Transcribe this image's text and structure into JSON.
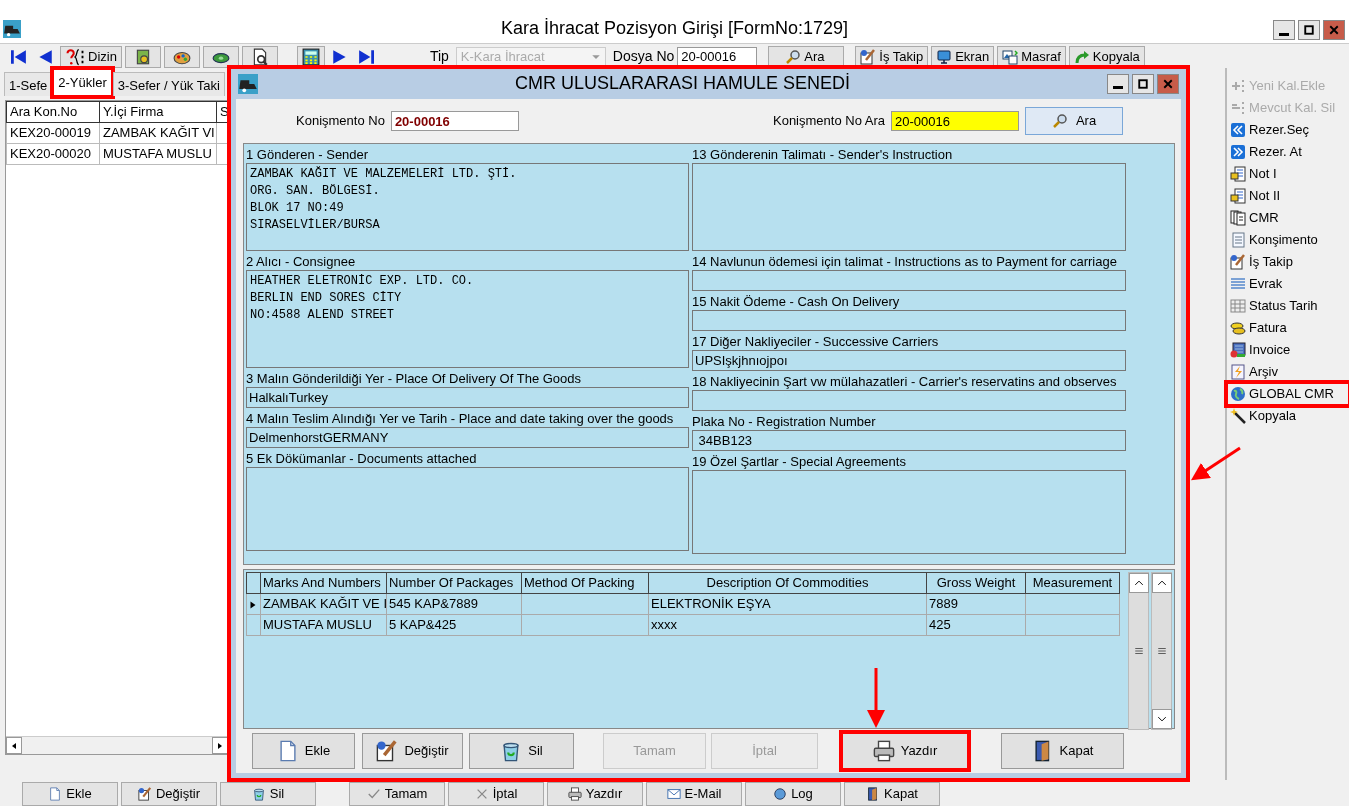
{
  "window": {
    "title": "Kara İhracat Pozisyon Girişi [FormNo:1729]"
  },
  "toolbar": {
    "index_button": "Dizin",
    "type_label": "Tip",
    "type_value": "K-Kara İhracat",
    "file_label": "Dosya No",
    "file_value": "20-00016",
    "search_button": "Ara",
    "buttons": [
      "İş Takip",
      "Ekran",
      "Masraf",
      "Kopyala"
    ]
  },
  "tabs": [
    {
      "label": "1-Sefe",
      "selected": false,
      "highlighted": false
    },
    {
      "label": "2-Yükler",
      "selected": true,
      "highlighted": true
    },
    {
      "label": "3-Sefer / Yük Taki",
      "selected": false,
      "highlighted": false
    }
  ],
  "left_table": {
    "columns": [
      "Ara Kon.No",
      "Y.İçi Firma",
      "S"
    ],
    "rows": [
      [
        "KEX20-00019",
        "ZAMBAK KAĞIT VI"
      ],
      [
        "KEX20-00020",
        "MUSTAFA MUSLU"
      ]
    ]
  },
  "sidebar": {
    "items": [
      {
        "label": "Yeni Kal.Ekle",
        "disabled": true,
        "highlighted": false
      },
      {
        "label": "Mevcut Kal. Sil",
        "disabled": true,
        "highlighted": false
      },
      {
        "label": "Rezer.Seç",
        "disabled": false,
        "highlighted": false
      },
      {
        "label": "Rezer. At",
        "disabled": false,
        "highlighted": false
      },
      {
        "label": "Not I",
        "disabled": false,
        "highlighted": false
      },
      {
        "label": "Not II",
        "disabled": false,
        "highlighted": false
      },
      {
        "label": "CMR",
        "disabled": false,
        "highlighted": false
      },
      {
        "label": "Konşimento",
        "disabled": false,
        "highlighted": false
      },
      {
        "label": "İş Takip",
        "disabled": false,
        "highlighted": false
      },
      {
        "label": "Evrak",
        "disabled": false,
        "highlighted": false
      },
      {
        "label": "Status Tarih",
        "disabled": false,
        "highlighted": false
      },
      {
        "label": "Fatura",
        "disabled": false,
        "highlighted": false
      },
      {
        "label": "Invoice",
        "disabled": false,
        "highlighted": false
      },
      {
        "label": "Arşiv",
        "disabled": false,
        "highlighted": false
      },
      {
        "label": "GLOBAL CMR",
        "disabled": false,
        "highlighted": true
      },
      {
        "label": "Kopyala",
        "disabled": false,
        "highlighted": false
      }
    ]
  },
  "bottom_buttons": [
    "Ekle",
    "Değiştir",
    "Sil",
    "Tamam",
    "İptal",
    "Yazdır",
    "E-Mail",
    "Log",
    "Kapat"
  ],
  "dialog": {
    "title": "CMR ULUSLARARASI HAMULE SENEDİ",
    "highlighted": true,
    "bill_no": {
      "label": "Konişmento No",
      "value": "20-00016"
    },
    "bill_search": {
      "label": "Konişmento No Ara",
      "value": "20-00016",
      "button": "Ara"
    },
    "left_fields": [
      {
        "kind": "multiline",
        "label": "1 Gönderen - Sender",
        "value": "ZAMBAK KAĞIT VE MALZEMELERİ LTD. ŞTİ.\nORG. SAN. BÖLGESİ.\nBLOK 17 NO:49\nSIRASELVİLER/BURSA"
      },
      {
        "kind": "multiline",
        "label": "2 Alıcı - Consignee",
        "value": "HEATHER ELETRONİC EXP. LTD. CO.\nBERLIN END SORES CİTY\nNO:4588 ALEND STREET"
      },
      {
        "kind": "line",
        "label": "3 Malın Gönderildiği Yer - Place Of Delivery Of The Goods",
        "value": "HalkalıTurkey"
      },
      {
        "kind": "line",
        "label": "4 Malın Teslim Alındığı Yer ve Tarih - Place and date taking over the goods",
        "value": "DelmenhorstGERMANY"
      },
      {
        "kind": "multiline",
        "label": "5 Ek Dökümanlar - Documents attached"
      }
    ],
    "right_fields": [
      {
        "kind": "multiline",
        "label": "13 Gönderenin Talimatı - Sender's Instruction"
      },
      {
        "kind": "line",
        "label": "14 Navlunun ödemesi için talimat - Instructions as to Payment for carriage"
      },
      {
        "kind": "line",
        "label": "15 Nakit Ödeme - Cash On Delivery"
      },
      {
        "kind": "line",
        "label": "17 Diğer Nakliyeciler - Successive Carriers",
        "value": "UPSIşkjhnıojpoı"
      },
      {
        "kind": "line",
        "label": "18 Nakliyecinin Şart vw mülahazatleri - Carrier's reservatins and observes"
      },
      {
        "kind": "line",
        "label": "Plaka No - Registration Number",
        "value": " 34BB123"
      },
      {
        "kind": "multiline",
        "label": "19 Özel Şartlar - Special Agreements"
      }
    ],
    "grid": {
      "columns": [
        "Marks And Numbers",
        "Number Of Packages",
        "Method Of Packing",
        "Description Of Commodities",
        "Gross Weight",
        "Measurement"
      ],
      "rows": [
        {
          "current": true,
          "cells": [
            "ZAMBAK KAĞIT VE I",
            "545 KAP&7889",
            "",
            "ELEKTRONİK EŞYA",
            "7889",
            ""
          ]
        },
        {
          "current": false,
          "cells": [
            "MUSTAFA MUSLU",
            "5 KAP&425",
            "",
            "xxxx",
            "425",
            ""
          ]
        }
      ]
    },
    "buttons": [
      {
        "label": "Ekle",
        "disabled": false,
        "highlighted": false
      },
      {
        "label": "Değiştir",
        "disabled": false,
        "highlighted": false
      },
      {
        "label": "Sil",
        "disabled": false,
        "highlighted": false
      },
      {
        "label": "Tamam",
        "disabled": true,
        "highlighted": false
      },
      {
        "label": "İptal",
        "disabled": true,
        "highlighted": false
      },
      {
        "label": "Yazdır",
        "disabled": false,
        "highlighted": true
      },
      {
        "label": "Kapat",
        "disabled": false,
        "highlighted": false
      }
    ]
  }
}
